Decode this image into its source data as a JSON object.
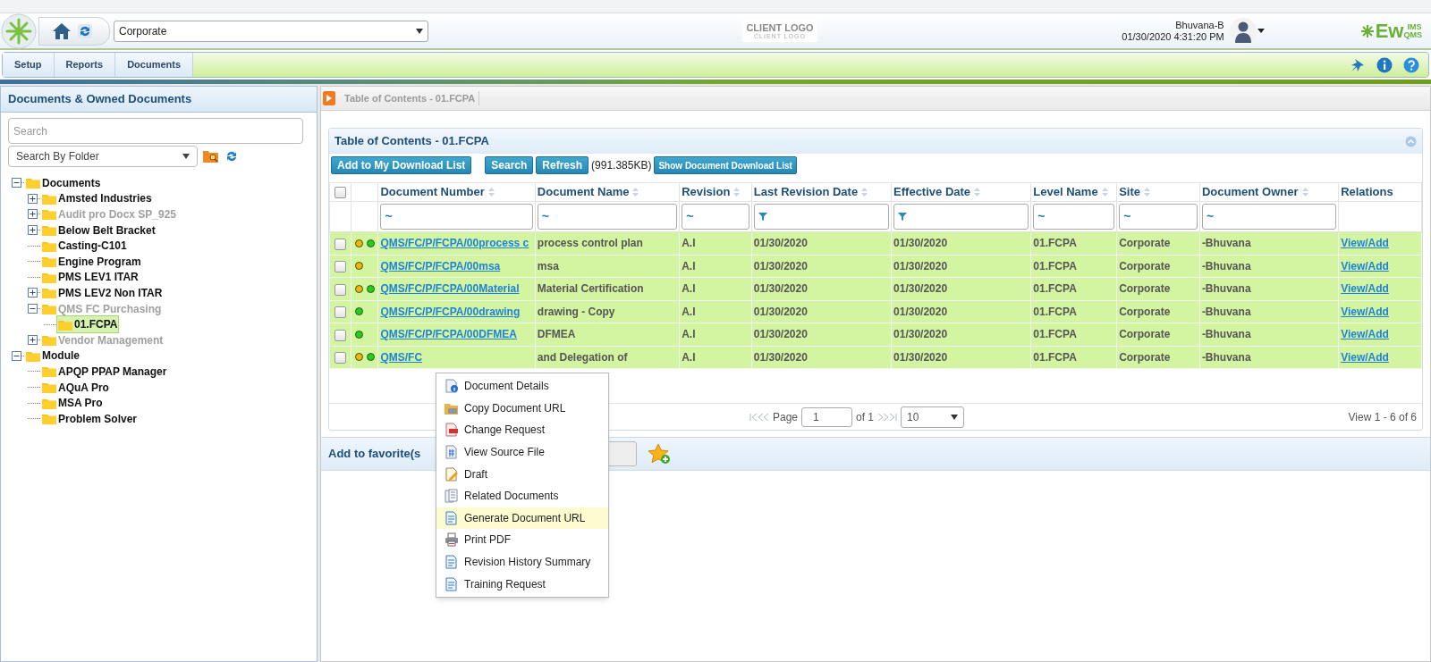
{
  "header": {
    "location": "Corporate",
    "client_logo": {
      "title": "CLIENT LOGO",
      "subtitle": "CLIENT LOGO"
    },
    "user": {
      "name": "Bhuvana-B",
      "datetime": "01/30/2020 4:31:20 PM"
    },
    "brand": {
      "main": "Ew",
      "top": "IMS",
      "bottom": "QMS"
    }
  },
  "nav": [
    {
      "label": "Setup"
    },
    {
      "label": "Reports"
    },
    {
      "label": "Documents"
    }
  ],
  "sidebar": {
    "title": "Documents & Owned Documents",
    "search": {
      "placeholder": "Search"
    },
    "filter": "Search By Folder",
    "tree": [
      {
        "label": "Documents",
        "expanded": true,
        "muted": false,
        "selected": false,
        "children": [
          {
            "label": "Amsted Industries",
            "expanded": false,
            "muted": false,
            "selected": false
          },
          {
            "label": "Audit pro Docx SP_925",
            "expanded": false,
            "muted": true,
            "selected": false
          },
          {
            "label": "Below Belt Bracket",
            "expanded": false,
            "muted": false,
            "selected": false
          },
          {
            "label": "Casting-C101",
            "muted": false,
            "selected": false
          },
          {
            "label": "Engine Program",
            "muted": false,
            "selected": false
          },
          {
            "label": "PMS LEV1 ITAR",
            "muted": false,
            "selected": false
          },
          {
            "label": "PMS LEV2 Non ITAR",
            "expanded": false,
            "muted": false,
            "selected": false
          },
          {
            "label": "QMS FC Purchasing",
            "expanded": true,
            "muted": true,
            "selected": false,
            "children": [
              {
                "label": "01.FCPA",
                "muted": false,
                "selected": true
              }
            ]
          },
          {
            "label": "Vendor Management",
            "expanded": false,
            "muted": true,
            "selected": false
          }
        ]
      },
      {
        "label": "Module",
        "expanded": true,
        "muted": false,
        "selected": false,
        "children": [
          {
            "label": "APQP PPAP Manager",
            "muted": false,
            "selected": false
          },
          {
            "label": "AQuA Pro",
            "muted": false,
            "selected": false
          },
          {
            "label": "MSA Pro",
            "muted": false,
            "selected": false
          },
          {
            "label": "Problem Solver",
            "muted": false,
            "selected": false
          }
        ]
      }
    ]
  },
  "breadcrumb": [
    "Table of Contents - 01.FCPA"
  ],
  "panel": {
    "title": "Table of Contents - 01.FCPA",
    "buttons": [
      "Add to My Download List",
      "Search",
      "Refresh"
    ],
    "size": "(991.385KB)",
    "download_button": "Show Document Download List",
    "header_checkbox": {
      "checked": false
    },
    "columns": [
      {
        "label": "Document Number",
        "kind": "link",
        "sortable": true,
        "filter": {
          "kind": "text",
          "value": "~"
        }
      },
      {
        "label": "Document Name",
        "kind": "text",
        "sortable": true,
        "filter": {
          "kind": "text",
          "value": "~"
        }
      },
      {
        "label": "Revision",
        "kind": "text",
        "sortable": true,
        "filter": {
          "kind": "text",
          "value": "~"
        }
      },
      {
        "label": "Last Revision Date",
        "kind": "text",
        "sortable": true,
        "filter": {
          "kind": "date"
        }
      },
      {
        "label": "Effective Date",
        "kind": "text",
        "sortable": true,
        "filter": {
          "kind": "date"
        }
      },
      {
        "label": "Level Name",
        "kind": "text",
        "sortable": true,
        "filter": {
          "kind": "text",
          "value": "~"
        }
      },
      {
        "label": "Site",
        "kind": "text",
        "sortable": true,
        "filter": {
          "kind": "text",
          "value": "~"
        }
      },
      {
        "label": "Document Owner",
        "kind": "text",
        "sortable": true,
        "filter": {
          "kind": "text",
          "value": "~"
        }
      },
      {
        "label": "Relations",
        "kind": "link",
        "sortable": false,
        "filter": {
          "kind": "none"
        }
      }
    ],
    "rows": [
      {
        "checked": false,
        "indicators": [
          {
            "color": "#f9b208"
          },
          {
            "color": "#22cc22"
          }
        ],
        "cells": [
          "QMS/FC/P/FCPA/00process c",
          "process control plan",
          "A.I",
          "01/30/2020",
          "01/30/2020",
          "01.FCPA",
          "Corporate",
          "-Bhuvana",
          "View/Add"
        ]
      },
      {
        "checked": false,
        "indicators": [
          {
            "color": "#f9b208"
          }
        ],
        "cells": [
          "QMS/FC/P/FCPA/00msa",
          "msa",
          "A.I",
          "01/30/2020",
          "01/30/2020",
          "01.FCPA",
          "Corporate",
          "-Bhuvana",
          "View/Add"
        ]
      },
      {
        "checked": false,
        "indicators": [
          {
            "color": "#f9b208"
          },
          {
            "color": "#22cc22"
          }
        ],
        "cells": [
          "QMS/FC/P/FCPA/00Material",
          "Material Certification",
          "A.I",
          "01/30/2020",
          "01/30/2020",
          "01.FCPA",
          "Corporate",
          "-Bhuvana",
          "View/Add"
        ]
      },
      {
        "checked": false,
        "indicators": [
          {
            "color": "#22cc22"
          }
        ],
        "cells": [
          "QMS/FC/P/FCPA/00drawing",
          "drawing - Copy",
          "A.I",
          "01/30/2020",
          "01/30/2020",
          "01.FCPA",
          "Corporate",
          "-Bhuvana",
          "View/Add"
        ]
      },
      {
        "checked": false,
        "indicators": [
          {
            "color": "#22cc22"
          }
        ],
        "cells": [
          "QMS/FC/P/FCPA/00DFMEA",
          "DFMEA",
          "A.I",
          "01/30/2020",
          "01/30/2020",
          "01.FCPA",
          "Corporate",
          "-Bhuvana",
          "View/Add"
        ]
      },
      {
        "checked": false,
        "indicators": [
          {
            "color": "#f9b208"
          },
          {
            "color": "#22cc22"
          }
        ],
        "cells": [
          "QMS/FC",
          "and Delegation of",
          "A.I",
          "01/30/2020",
          "01/30/2020",
          "01.FCPA",
          "Corporate",
          "-Bhuvana",
          "View/Add"
        ]
      }
    ],
    "pager": {
      "page_label": "Page",
      "page": "1",
      "of": "of 1",
      "page_size": "10",
      "summary": "View 1 - 6 of 6"
    }
  },
  "favorites": {
    "label": "Add to favorite(s"
  },
  "context_menu": [
    {
      "label": "Document Details",
      "selected": false
    },
    {
      "label": "Copy Document URL",
      "selected": false
    },
    {
      "label": "Change Request",
      "selected": false
    },
    {
      "label": "View Source File",
      "selected": false
    },
    {
      "label": "Draft",
      "selected": false
    },
    {
      "label": "Related Documents",
      "selected": false
    },
    {
      "label": "Generate Document URL",
      "selected": true
    },
    {
      "label": "Print PDF",
      "selected": false
    },
    {
      "label": "Revision History Summary",
      "selected": false
    },
    {
      "label": "Training Request",
      "selected": false
    }
  ]
}
